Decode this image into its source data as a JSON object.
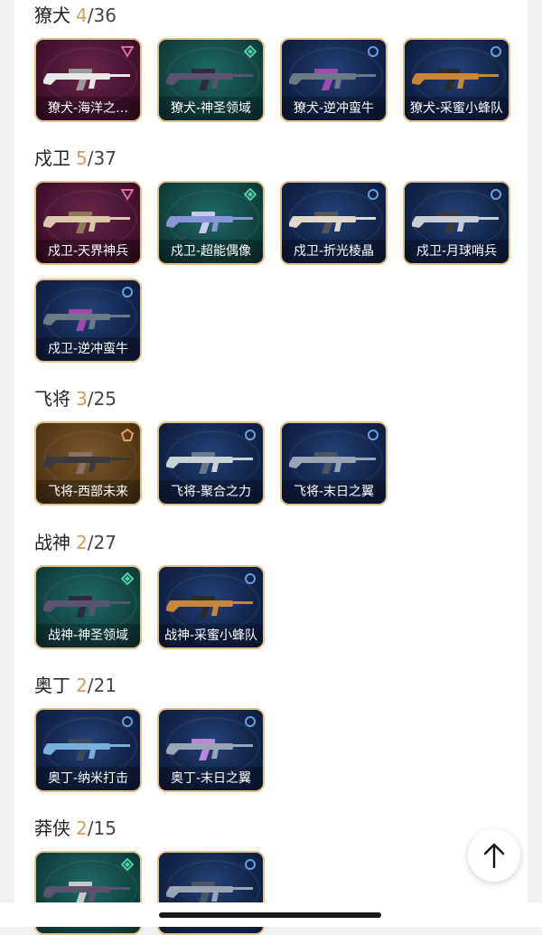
{
  "sections": [
    {
      "name": "獠犬",
      "owned": "4",
      "total": "/36",
      "items": [
        {
          "label": "獠犬-海洋之…",
          "theme": "maroon",
          "tier_icon": "triangle-tier-icon",
          "gun_color": "#e8e8e8",
          "accent": "#9a9a9a"
        },
        {
          "label": "獠犬-神圣领域",
          "theme": "teal",
          "tier_icon": "diamond-tier-icon",
          "gun_color": "#5a5470",
          "accent": "#2f2a3c"
        },
        {
          "label": "獠犬-逆冲蛮牛",
          "theme": "navy",
          "tier_icon": "circle-tier-icon",
          "gun_color": "#6c7a86",
          "accent": "#a04ab0"
        },
        {
          "label": "獠犬-采蜜小蜂队",
          "theme": "navy",
          "tier_icon": "circle-tier-icon",
          "gun_color": "#c9853a",
          "accent": "#2a2a2a"
        }
      ]
    },
    {
      "name": "戍卫",
      "owned": "5",
      "total": "/37",
      "items": [
        {
          "label": "戍卫-天界神兵",
          "theme": "maroon",
          "tier_icon": "triangle-tier-icon",
          "gun_color": "#d9c9a8",
          "accent": "#8a7a5a"
        },
        {
          "label": "戍卫-超能偶像",
          "theme": "teal",
          "tier_icon": "diamond-tier-icon",
          "gun_color": "#8a94d8",
          "accent": "#c8c8f0"
        },
        {
          "label": "戍卫-折光棱晶",
          "theme": "navy",
          "tier_icon": "circle-tier-icon",
          "gun_color": "#e0d8c8",
          "accent": "#555"
        },
        {
          "label": "戍卫-月球哨兵",
          "theme": "navy",
          "tier_icon": "circle-tier-icon",
          "gun_color": "#c8ccd4",
          "accent": "#3a3a3a"
        },
        {
          "label": "戍卫-逆冲蛮牛",
          "theme": "navy",
          "tier_icon": "circle-tier-icon",
          "gun_color": "#6c7a86",
          "accent": "#a04ab0"
        }
      ]
    },
    {
      "name": "飞将",
      "owned": "3",
      "total": "/25",
      "items": [
        {
          "label": "飞将-西部未来",
          "theme": "bronze",
          "tier_icon": "pentagon-tier-icon",
          "gun_color": "#3a3a3a",
          "accent": "#8a7060"
        },
        {
          "label": "飞将-聚合之力",
          "theme": "navy",
          "tier_icon": "circle-tier-icon",
          "gun_color": "#c8d0d8",
          "accent": "#6a7a88"
        },
        {
          "label": "飞将-末日之翼",
          "theme": "navy",
          "tier_icon": "circle-tier-icon",
          "gun_color": "#9aa4b4",
          "accent": "#4a5462"
        }
      ]
    },
    {
      "name": "战神",
      "owned": "2",
      "total": "/27",
      "items": [
        {
          "label": "战神-神圣领域",
          "theme": "teal",
          "tier_icon": "diamond-tier-icon",
          "gun_color": "#5a5470",
          "accent": "#2f2a3c"
        },
        {
          "label": "战神-采蜜小蜂队",
          "theme": "navy",
          "tier_icon": "circle-tier-icon",
          "gun_color": "#c9853a",
          "accent": "#2a2a2a"
        }
      ]
    },
    {
      "name": "奥丁",
      "owned": "2",
      "total": "/21",
      "items": [
        {
          "label": "奥丁-纳米打击",
          "theme": "navy",
          "tier_icon": "circle-tier-icon",
          "gun_color": "#7ab0d8",
          "accent": "#3a4a5a"
        },
        {
          "label": "奥丁-末日之翼",
          "theme": "navy",
          "tier_icon": "circle-tier-icon",
          "gun_color": "#9aa4b4",
          "accent": "#b888d8"
        }
      ]
    },
    {
      "name": "莽侠",
      "owned": "2",
      "total": "/15",
      "items": [
        {
          "label": "",
          "theme": "teal",
          "tier_icon": "diamond-tier-icon",
          "gun_color": "#5a5470",
          "accent": "#c8c8c8"
        },
        {
          "label": "",
          "theme": "navy",
          "tier_icon": "circle-tier-icon",
          "gun_color": "#9aa4b4",
          "accent": "#4a5462"
        }
      ]
    }
  ],
  "colors": {
    "owned_count": "#c8a15a",
    "card_border": "#e2c08a",
    "tier_circle": "#5fa3e0",
    "tier_diamond": "#4fd1a8",
    "tier_triangle": "#e06aa8",
    "tier_pentagon": "#e8a060"
  },
  "scroll_top_button": {
    "icon": "arrow-up-icon"
  }
}
